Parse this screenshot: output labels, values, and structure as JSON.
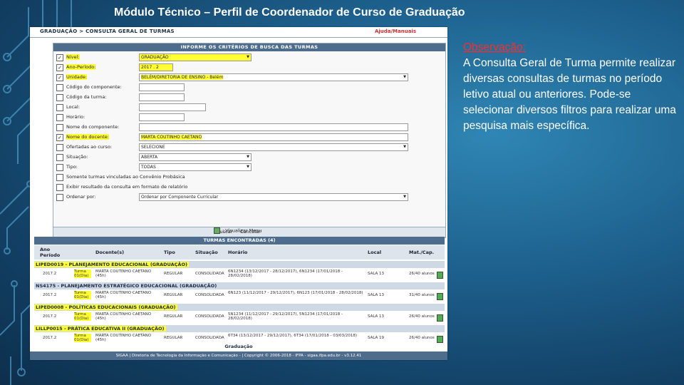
{
  "slide": {
    "title": "Módulo Técnico – Perfil de Coordenador de Curso de Graduação",
    "obs_heading": "Observação:",
    "obs_text": "A Consulta Geral de Turma permite realizar diversas consultas de turmas no período letivo atual ou anteriores. Pode-se selecionar diversos filtros para realizar uma pesquisa mais específica."
  },
  "app": {
    "breadcrumb": "GRADUAÇÃO > CONSULTA GERAL DE TURMAS",
    "help": "Ajuda/Manuais",
    "form_title": "INFORME OS CRITÉRIOS DE BUSCA DAS TURMAS",
    "fields": [
      {
        "label": "Nível:",
        "value": "GRADUAÇÃO",
        "checked": true
      },
      {
        "label": "Ano-Período:",
        "value": "2017 . 2",
        "checked": true
      },
      {
        "label": "Unidade:",
        "value": "BELÉM/DIRETORIA DE ENSINO - Belém",
        "checked": true
      },
      {
        "label": "Código do componente:",
        "value": "",
        "checked": false
      },
      {
        "label": "Código da turma:",
        "value": "",
        "checked": false
      },
      {
        "label": "Local:",
        "value": "",
        "checked": false
      },
      {
        "label": "Horário:",
        "value": "",
        "checked": false
      },
      {
        "label": "Nome do componente:",
        "value": "",
        "checked": false
      },
      {
        "label": "Nome do docente:",
        "value": "MARTA COUTINHO CAETANO",
        "checked": true
      },
      {
        "label": "Ofertadas ao curso:",
        "value": "SELECIONE",
        "checked": false
      },
      {
        "label": "Situação:",
        "value": "ABERTA",
        "checked": false
      },
      {
        "label": "Tipo:",
        "value": "TODAS",
        "checked": false
      },
      {
        "label": "Somente turmas vinculadas ao Convênio Probásica",
        "value": "",
        "checked": false
      },
      {
        "label": "Exibir resultado da consulta em formato de relatório",
        "value": "",
        "checked": false
      },
      {
        "label": "Ordenar por:",
        "value": "Ordenar por Componente Curricular",
        "checked": false
      }
    ],
    "btn_search": "Buscar",
    "btn_cancel": "Cancelar",
    "viz_label": ": Visualizar Menu",
    "results_title": "TURMAS ENCONTRADAS (4)",
    "columns": {
      "ano": "Ano Período",
      "docente": "Docente(s)",
      "tipo": "Tipo",
      "situacao": "Situação",
      "horario": "Horário",
      "local": "Local",
      "mat": "Mat./Cap."
    },
    "groups": [
      {
        "title": "LIPED0019 - PLANEJAMENTO EDUCACIONAL (GRADUAÇÃO)",
        "ano": "2017.2",
        "turma": "Turma 01(Dia)",
        "docente": "MARTA COUTINHO CAETANO (45h)",
        "tipo": "REGULAR",
        "situacao": "CONSOLIDADA",
        "horario": "6N1234 (13/12/2017 - 28/12/2017), 6N1234 (17/01/2018 - 28/02/2018)",
        "local": "SALA 13",
        "mat": "26/40 alunos"
      },
      {
        "title": "NS4175 - PLANEJAMENTO ESTRATÉGICO EDUCACIONAL (GRADUAÇÃO)",
        "ano": "2017.2",
        "turma": "Turma 01(Dia)",
        "docente": "MARTA COUTINHO CAETANO (45h)",
        "tipo": "REGULAR",
        "situacao": "CONSOLIDADA",
        "horario": "6N123 (11/12/2017 - 29/12/2017), 6N123 (17/01/2018 - 28/02/2018)",
        "local": "SALA 13",
        "mat": "31/40 alunos"
      },
      {
        "title": "LIPED0008 - POLÍTICAS EDUCACIONAIS (GRADUAÇÃO)",
        "ano": "2017.2",
        "turma": "Turma 01(Dia)",
        "docente": "MARTA COUTINHO CAETANO (45h)",
        "tipo": "REGULAR",
        "situacao": "CONSOLIDADA",
        "horario": "5N1234 (11/12/2017 - 29/12/2017), 5N1234 (17/01/2018 - 28/02/2018)",
        "local": "SALA 13",
        "mat": "26/40 alunos"
      },
      {
        "title": "LILLP0015 - PRÁTICA EDUCATIVA II (GRADUAÇÃO)",
        "ano": "2017.2",
        "turma": "Turma 01(Dia)",
        "docente": "MARTA COUTINHO CAETANO (45h)",
        "tipo": "REGULAR",
        "situacao": "CONSOLIDADA",
        "horario": "6T34 (13/12/2017 - 29/12/2017), 6T34 (17/01/2018 - 03/03/2018)",
        "local": "SALA 19",
        "mat": "26/40 alunos"
      }
    ],
    "footer_link": "Graduação",
    "footer_text": "SIGAA | Diretoria de Tecnologia da Informação e Comunicação - | Copyright © 2006-2018 - IFPA - sigaa.ifpa.edu.br - v3.12.41"
  }
}
